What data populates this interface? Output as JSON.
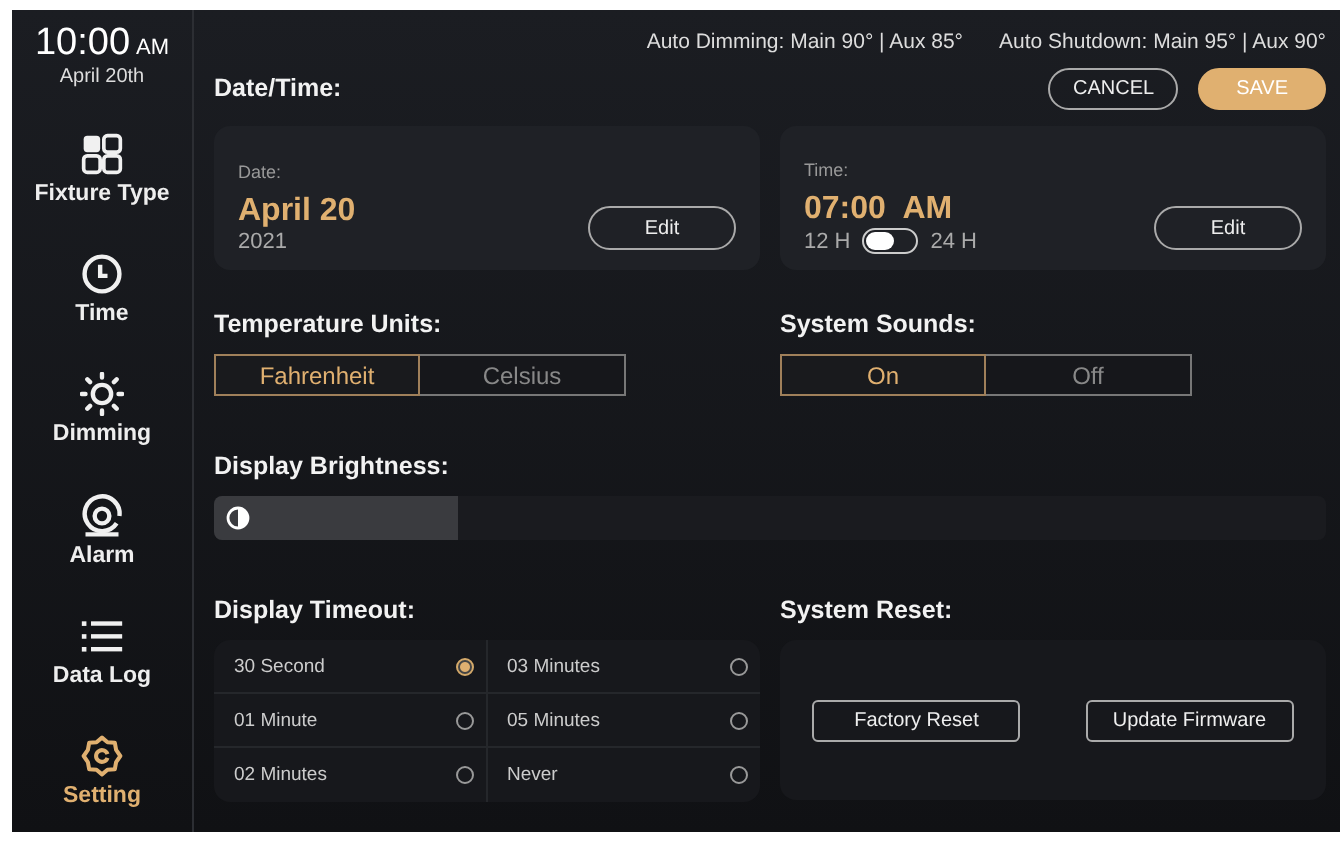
{
  "clock": {
    "time": "10:00",
    "meridiem": "AM",
    "date": "April 20th"
  },
  "status": [
    "Auto Dimming: Main 90° | Aux 85°",
    "Auto Shutdown: Main 95° | Aux 90°"
  ],
  "sidebar": {
    "items": [
      {
        "label": "Fixture Type",
        "selected": false
      },
      {
        "label": "Time",
        "selected": false
      },
      {
        "label": "Dimming",
        "selected": false
      },
      {
        "label": "Alarm",
        "selected": false
      },
      {
        "label": "Data Log",
        "selected": false
      },
      {
        "label": "Setting",
        "selected": true
      }
    ]
  },
  "actions": {
    "cancel": "CANCEL",
    "save": "SAVE"
  },
  "date_time": {
    "heading": "Date/Time:",
    "date": {
      "label": "Date:",
      "value": "April 20",
      "sub": "2021",
      "button": "Edit"
    },
    "time": {
      "label": "Time:",
      "value": "07:00  AM",
      "format_12": "12 H",
      "format_24": "24 H",
      "format_24h": false,
      "button": "Edit"
    }
  },
  "temperature_units": {
    "heading": "Temperature Units:",
    "options": [
      {
        "label": "Fahrenheit",
        "selected": true
      },
      {
        "label": "Celsius",
        "selected": false
      }
    ]
  },
  "system_sounds": {
    "heading": "System Sounds:",
    "options": [
      {
        "label": "On",
        "selected": true
      },
      {
        "label": "Off",
        "selected": false
      }
    ]
  },
  "display_brightness": {
    "heading": "Display Brightness:",
    "level": 0.22
  },
  "display_timeout": {
    "heading": "Display Timeout:",
    "options": [
      {
        "label": "30 Second",
        "selected": true
      },
      {
        "label": "03 Minutes",
        "selected": false
      },
      {
        "label": "01 Minute",
        "selected": false
      },
      {
        "label": "05 Minutes",
        "selected": false
      },
      {
        "label": "02 Minutes",
        "selected": false
      },
      {
        "label": "Never",
        "selected": false
      }
    ]
  },
  "system_reset": {
    "heading": "System Reset:",
    "buttons": [
      "Factory Reset",
      "Update Firmware"
    ]
  }
}
